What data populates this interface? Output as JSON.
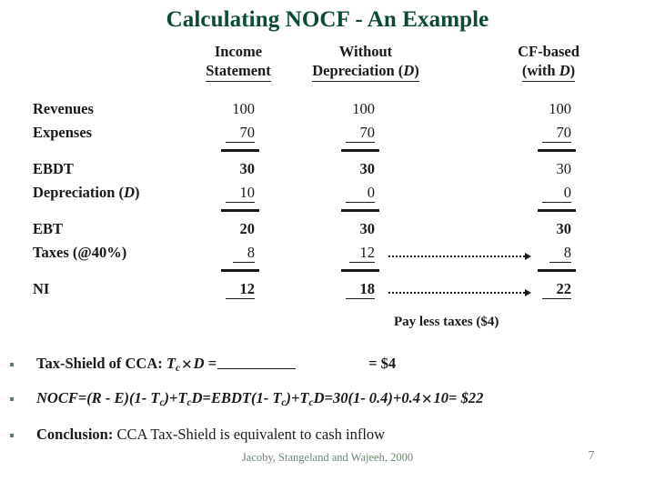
{
  "slide": {
    "title": "Calculating NOCF - An Example",
    "accent_color": "#0d4a33",
    "bullet_color": "#5f7a62",
    "footer_color": "#6b8870"
  },
  "table": {
    "columns": [
      {
        "line1": "Income",
        "line2": "Statement"
      },
      {
        "line1": "Without",
        "line2": "Depreciation (D)"
      },
      {
        "line1": "CF-based",
        "line2": "(with D)"
      }
    ],
    "rows": [
      {
        "label": "Revenues",
        "values": [
          "100",
          "100",
          "100"
        ]
      },
      {
        "label": "Expenses",
        "values": [
          "70",
          "70",
          "70"
        ]
      },
      {
        "label": "EBDT",
        "values": [
          "30",
          "30",
          "30"
        ]
      },
      {
        "label": "Depreciation (D)",
        "values": [
          "10",
          "0",
          "0"
        ]
      },
      {
        "label": "EBT",
        "values": [
          "20",
          "30",
          "30"
        ]
      },
      {
        "label": "Taxes (@40%)",
        "values": [
          "8",
          "12",
          "8"
        ]
      },
      {
        "label": "NI",
        "values": [
          "12",
          "18",
          "22"
        ]
      }
    ]
  },
  "annotation": {
    "note": "Pay less taxes ($4)"
  },
  "bullets": [
    {
      "id": "tax-shield",
      "lead": "Tax-Shield of CCA: ",
      "formula_a": "T",
      "formula_a_sub": "c",
      "times": "✕",
      "formula_b": "D",
      "equals": " =",
      "result": "= $4"
    },
    {
      "id": "nocf-formula",
      "text_1": "NOCF",
      "text_2": "=(R - E)(1- T",
      "sub_1": "c",
      "text_3": ")+T",
      "sub_2": "c",
      "text_4": "D=EBDT(1- T",
      "sub_3": "c",
      "text_5": ")+T",
      "sub_4": "c",
      "text_6": "D=30(1- 0.4)+0.4",
      "times": "✕",
      "text_7": "10= $22"
    },
    {
      "id": "conclusion",
      "lead": "Conclusion:",
      "body": "  CCA Tax-Shield is equivalent to cash inflow"
    }
  ],
  "footer": {
    "credit": "Jacoby, Stangeland and Wajeeh, 2000",
    "page_number": "7"
  }
}
